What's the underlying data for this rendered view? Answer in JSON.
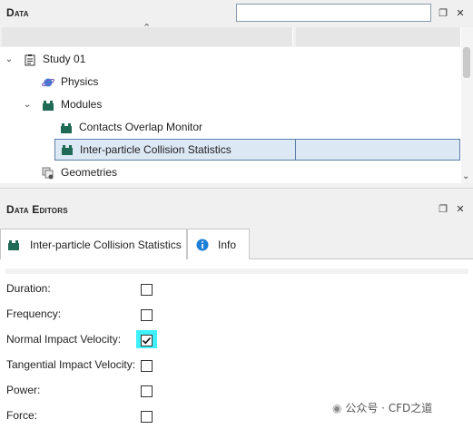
{
  "data_panel": {
    "title": "Data",
    "search_placeholder": "",
    "restore_icon": "restore-icon",
    "close_icon": "close-icon",
    "tree": [
      {
        "label": "Study 01",
        "icon": "clipboard-icon",
        "expanded": true
      },
      {
        "label": "Physics",
        "icon": "planet-icon"
      },
      {
        "label": "Modules",
        "icon": "module-icon",
        "expanded": true
      },
      {
        "label": "Contacts Overlap Monitor",
        "icon": "module-icon"
      },
      {
        "label": "Inter-particle Collision Statistics",
        "icon": "module-icon",
        "selected": true
      },
      {
        "label": "Geometries",
        "icon": "geometries-icon"
      }
    ]
  },
  "editors_panel": {
    "title": "Data Editors",
    "tabs": [
      {
        "label": "Inter-particle Collision Statistics",
        "icon": "module-icon",
        "active": true
      },
      {
        "label": "Info",
        "icon": "info-icon",
        "active": false
      }
    ],
    "properties": [
      {
        "label": "Duration:",
        "checked": false
      },
      {
        "label": "Frequency:",
        "checked": false
      },
      {
        "label": "Normal Impact Velocity:",
        "checked": true
      },
      {
        "label": "Tangential Impact Velocity:",
        "checked": false
      },
      {
        "label": "Power:",
        "checked": false
      },
      {
        "label": "Force:",
        "checked": false
      }
    ]
  },
  "watermark": "公众号 · CFD之道",
  "colors": {
    "accent": "#1f6b55",
    "selection": "#dde8f5",
    "highlight": "#3ff0ff",
    "info": "#1e7fd6"
  }
}
